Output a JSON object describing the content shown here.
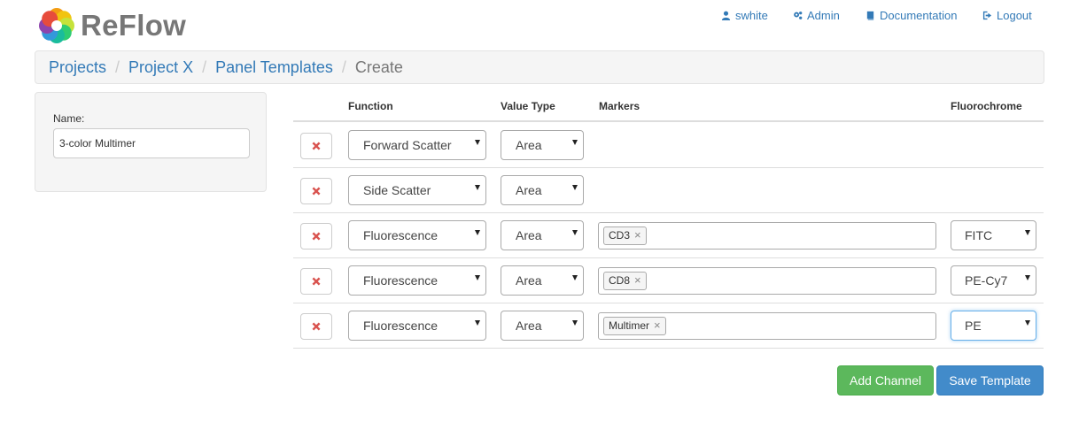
{
  "app": {
    "logo_text": "ReFlow"
  },
  "nav": {
    "user": "swhite",
    "admin": "Admin",
    "documentation": "Documentation",
    "logout": "Logout"
  },
  "breadcrumb": {
    "projects": "Projects",
    "project": "Project X",
    "panel_templates": "Panel Templates",
    "current": "Create",
    "separator": "/"
  },
  "form": {
    "name_label": "Name:",
    "name_value": "3-color Multimer"
  },
  "table": {
    "headers": {
      "function": "Function",
      "value_type": "Value Type",
      "markers": "Markers",
      "fluorochrome": "Fluorochrome"
    },
    "rows": [
      {
        "function": "Forward Scatter",
        "value_type": "Area",
        "marker": null,
        "fluorochrome": null
      },
      {
        "function": "Side Scatter",
        "value_type": "Area",
        "marker": null,
        "fluorochrome": null
      },
      {
        "function": "Fluorescence",
        "value_type": "Area",
        "marker": "CD3",
        "fluorochrome": "FITC"
      },
      {
        "function": "Fluorescence",
        "value_type": "Area",
        "marker": "CD8",
        "fluorochrome": "PE-Cy7"
      },
      {
        "function": "Fluorescence",
        "value_type": "Area",
        "marker": "Multimer",
        "fluorochrome": "PE"
      }
    ]
  },
  "buttons": {
    "add_channel": "Add Channel",
    "save_template": "Save Template"
  },
  "colors": {
    "link": "#337ab7",
    "delete": "#d9534f",
    "success": "#5cb85c",
    "primary": "#428bca"
  },
  "icons": {
    "user": "user-icon",
    "admin": "cogs-icon",
    "documentation": "book-icon",
    "logout": "logout-icon",
    "delete": "remove-icon"
  }
}
